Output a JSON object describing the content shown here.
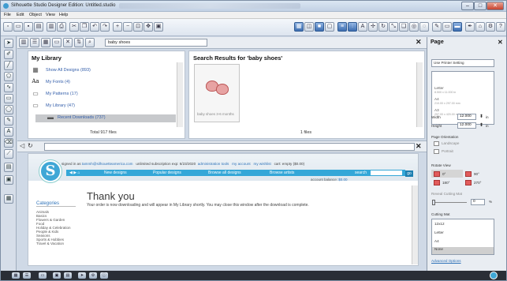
{
  "window": {
    "title": "Silhouette Studio Designer Edition: Untitled.studio",
    "controls": [
      "–",
      "□",
      "✕"
    ]
  },
  "menu": [
    "File",
    "Edit",
    "Object",
    "View",
    "Help"
  ],
  "library_bar": {
    "search_value": "baby shoes"
  },
  "my_library": {
    "header": "My Library",
    "items": [
      {
        "label": "Show All Designs (893)",
        "icon": "grid-icon"
      },
      {
        "label": "My Fonts (4)",
        "icon": "font-icon"
      },
      {
        "label": "My Patterns (17)",
        "icon": "folder-icon"
      },
      {
        "label": "My Library (47)",
        "icon": "folder-icon"
      },
      {
        "label": "Recent Downloads (737)",
        "icon": "folder-icon"
      }
    ],
    "font_glyph": "Aa",
    "total": "Total 917 files"
  },
  "search_results": {
    "header": "Search Results for 'baby shoes'",
    "thumb_caption": "baby shoes 3-6 months",
    "total": "1 files"
  },
  "web": {
    "logo_letter": "S",
    "signed_in_prefix": "signed in as",
    "user": "tammh@silhouetteamerica.com",
    "subscription": "unlimited subscription exp: 6/23/2020",
    "links": [
      "administration tools",
      "my account",
      "my wishlist",
      "cart: empty ($0.00)"
    ],
    "nav": [
      "New designs",
      "Popular designs",
      "Browse all designs",
      "Browse artists"
    ],
    "search_label": "search",
    "go": "go",
    "balance_label": "account balance:",
    "balance_value": "$0.00",
    "thank_you": "Thank you",
    "message": "Your order is now downloading and will appear in My Library shortly. You may close this window after the download is complete.",
    "categories_header": "Categories",
    "categories": [
      "Animals",
      "Basics",
      "Flowers & Garden",
      "Food",
      "Holiday & Celebration",
      "People & Kids",
      "Seasons",
      "Sports & Hobbies",
      "Travel & Vacation"
    ]
  },
  "page_panel": {
    "title": "Page",
    "use_printer": "Use Printer Setting",
    "paper_options": [
      {
        "name": "Letter",
        "size": "8.500 x 11.000 in"
      },
      {
        "name": "A4",
        "size": "210.00 x 297.00 mm"
      },
      {
        "name": "A3",
        "size": "297.00 x 420.00 mm"
      }
    ],
    "width_label": "Width",
    "width_value": "12.000",
    "height_label": "Height",
    "height_value": "12.000",
    "unit": "in",
    "orientation_label": "Page Orientation",
    "landscape": "Landscape",
    "portrait": "Portrait",
    "rotate_label": "Rotate View",
    "rotations": [
      "0°",
      "90°",
      "180°",
      "270°"
    ],
    "reveal_label": "Reveal Cutting Mat",
    "reveal_value": "0",
    "reveal_unit": "%",
    "mat_label": "Cutting Mat",
    "mats": [
      "12x12",
      "Letter",
      "A4",
      "None"
    ],
    "advanced": "Advanced Options"
  }
}
